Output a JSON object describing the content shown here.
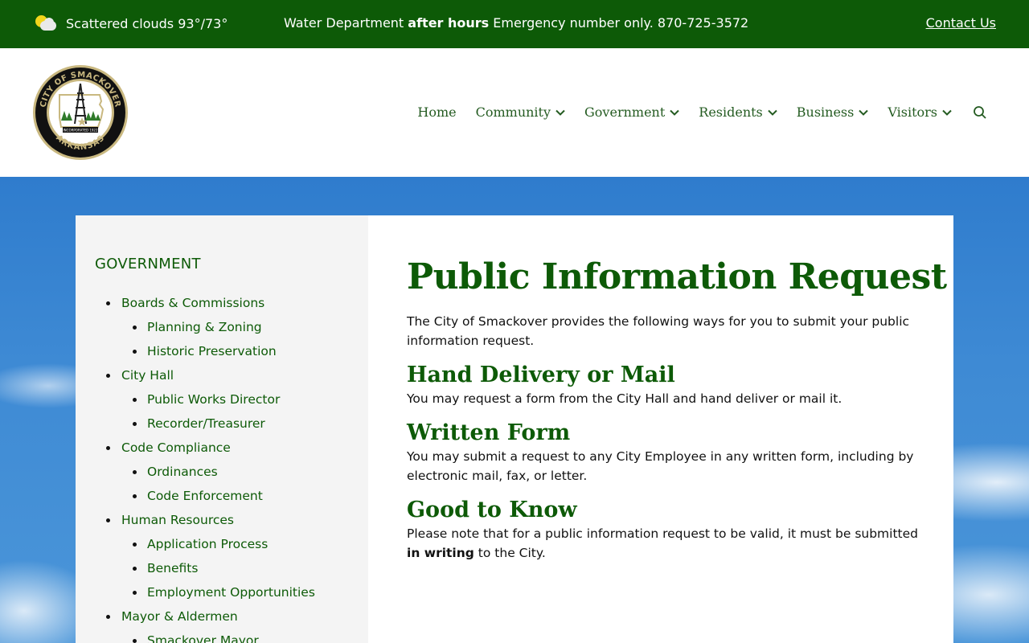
{
  "topbar": {
    "weather_text": "Scattered clouds 93°/73°",
    "weather_icon": "partly-cloudy-icon",
    "alert_part1": "Water Department ",
    "alert_bold": "after hours",
    "alert_part2": " Emergency number only. 870-725-3572",
    "contact_label": "Contact Us",
    "bg_color": "#0d5a07"
  },
  "logo": {
    "top_text": "CITY OF SMACKOVER",
    "bottom_text": "ARKANSAS",
    "banner_text": "INCORPORATED 1922"
  },
  "nav": {
    "items": [
      {
        "label": "Home",
        "has_dropdown": false
      },
      {
        "label": "Community",
        "has_dropdown": true
      },
      {
        "label": "Government",
        "has_dropdown": true
      },
      {
        "label": "Residents",
        "has_dropdown": true
      },
      {
        "label": "Business",
        "has_dropdown": true
      },
      {
        "label": "Visitors",
        "has_dropdown": true
      }
    ],
    "search_icon": "search-icon"
  },
  "sidebar": {
    "title": "GOVERNMENT",
    "items": [
      {
        "label": "Boards & Commissions",
        "level": 1
      },
      {
        "label": "Planning & Zoning",
        "level": 2
      },
      {
        "label": "Historic Preservation",
        "level": 2
      },
      {
        "label": "City Hall",
        "level": 1
      },
      {
        "label": "Public Works Director",
        "level": 2
      },
      {
        "label": "Recorder/Treasurer",
        "level": 2
      },
      {
        "label": "Code Compliance",
        "level": 1
      },
      {
        "label": "Ordinances",
        "level": 2
      },
      {
        "label": "Code Enforcement",
        "level": 2
      },
      {
        "label": "Human Resources",
        "level": 1
      },
      {
        "label": "Application Process",
        "level": 2
      },
      {
        "label": "Benefits",
        "level": 2
      },
      {
        "label": "Employment Opportunities",
        "level": 2
      },
      {
        "label": "Mayor & Aldermen",
        "level": 1
      },
      {
        "label": "Smackover Mayor",
        "level": 2
      }
    ]
  },
  "main": {
    "title": "Public Information Request",
    "intro": "The City of Smackover provides the following ways for you to submit your public information request.",
    "sections": [
      {
        "heading": "Hand Delivery or Mail",
        "text": "You may request a form from the City Hall and hand deliver or mail it."
      },
      {
        "heading": "Written Form",
        "text": "You may submit a request to any City Employee in any written form, including by electronic mail, fax, or letter."
      },
      {
        "heading": "Good to Know",
        "text_before": "Please note that for a public information request to be valid, it must be submitted ",
        "text_bold": "in writing",
        "text_after": " to the City."
      }
    ]
  },
  "colors": {
    "brand_green": "#0d5a07",
    "nav_green": "#245b21",
    "sidebar_bg": "#f4f4f4"
  }
}
